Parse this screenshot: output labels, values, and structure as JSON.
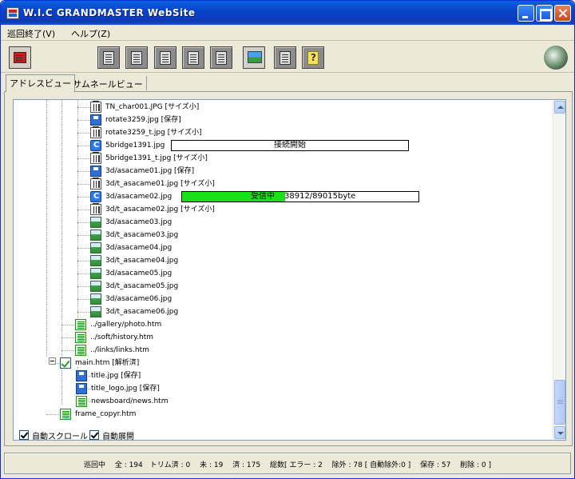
{
  "window": {
    "title": "W.I.C  GRANDMASTER WebSite"
  },
  "menu": [
    "巡回終了(V)",
    "ヘルプ(Z)"
  ],
  "toolbar": {
    "tools": [
      "stop-icon",
      "add-icon",
      "delete-icon",
      "edit-icon",
      "paste-icon",
      "clear-icon",
      "view-icon",
      "settings-icon",
      "help-icon",
      "globe-icon"
    ]
  },
  "tabs": [
    "アドレスビュー",
    "サムネールビュー"
  ],
  "tree": {
    "items": [
      {
        "icon": "trash",
        "label": "TN_char001.JPG [サイズ小]"
      },
      {
        "icon": "disk",
        "label": "rotate3259.jpg [保存]"
      },
      {
        "icon": "trash",
        "label": "rotate3259_t.jpg [サイズ小]"
      },
      {
        "icon": "conn",
        "label": "5bridge1391.jpg"
      },
      {
        "icon": "trash",
        "label": "5bridge1391_t.jpg [サイズ小]"
      },
      {
        "icon": "disk",
        "label": "3d/asacame01.jpg [保存]"
      },
      {
        "icon": "trash",
        "label": "3d/t_asacame01.jpg [サイズ小]"
      },
      {
        "icon": "conn",
        "label": "3d/asacame02.jpg"
      },
      {
        "icon": "trash",
        "label": "3d/t_asacame02.jpg [サイズ小]"
      },
      {
        "icon": "img",
        "label": "3d/asacame03.jpg"
      },
      {
        "icon": "img",
        "label": "3d/t_asacame03.jpg"
      },
      {
        "icon": "img",
        "label": "3d/asacame04.jpg"
      },
      {
        "icon": "img",
        "label": "3d/t_asacame04.jpg"
      },
      {
        "icon": "img",
        "label": "3d/asacame05.jpg"
      },
      {
        "icon": "img",
        "label": "3d/t_asacame05.jpg"
      },
      {
        "icon": "img",
        "label": "3d/asacame06.jpg"
      },
      {
        "icon": "img",
        "label": "3d/t_asacame06.jpg"
      }
    ],
    "pages": [
      {
        "icon": "htm",
        "label": "../gallery/photo.htm"
      },
      {
        "icon": "htm",
        "label": "../soft/history.htm"
      },
      {
        "icon": "htm",
        "label": "../links/links.htm"
      }
    ],
    "main": {
      "icon": "check",
      "label": "main.htm [解析済]"
    },
    "main_children": [
      {
        "icon": "disk",
        "label": "title.jpg [保存]"
      },
      {
        "icon": "disk",
        "label": "title_logo.jpg [保存]"
      },
      {
        "icon": "htm",
        "label": "newsboard/news.htm"
      }
    ],
    "root_last": {
      "icon": "htm",
      "label": "frame_copyr.htm"
    }
  },
  "transfer1": {
    "text": "接続開始"
  },
  "transfer2": {
    "status": "受信中",
    "progress": "38912/89015byte",
    "fraction": 0.437
  },
  "options": {
    "auto_scroll": "自動スクロール",
    "auto_expand": "自動展開"
  },
  "status": {
    "text": "巡回中　 全 : 194　トリム済 : 0　 未 : 19　 済 : 175　 総数[ エラー : 2　 除外 : 78 [ 自動除外:0 ]　 保存 : 57　 削除 : 0 ]"
  }
}
